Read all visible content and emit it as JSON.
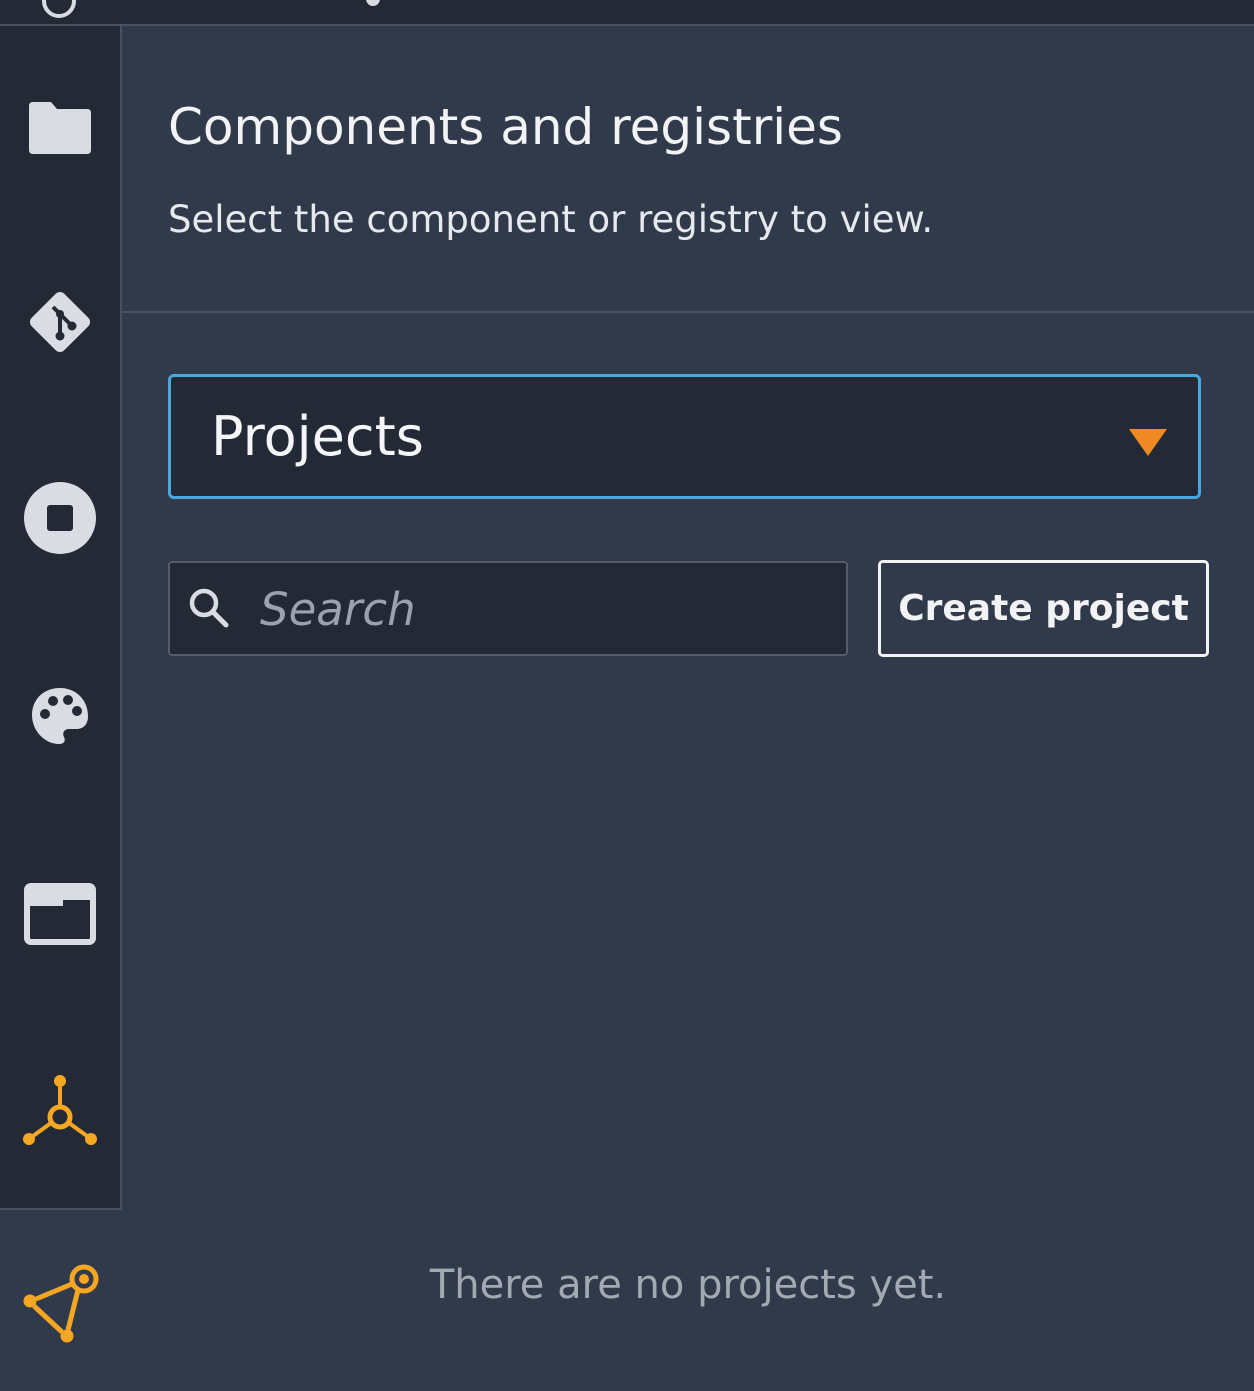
{
  "activity_bar": {
    "items": [
      {
        "icon": "folder-icon",
        "active": false
      },
      {
        "icon": "git-icon",
        "active": false
      },
      {
        "icon": "stop-icon",
        "active": false
      },
      {
        "icon": "palette-icon",
        "active": false
      },
      {
        "icon": "window-icon",
        "active": false
      },
      {
        "icon": "component-graph-icon",
        "active": true
      }
    ],
    "bottom_item": {
      "icon": "registry-graph-icon"
    }
  },
  "panel": {
    "title": "Components and registries",
    "subtitle": "Select the component or registry to view."
  },
  "selector": {
    "selected": "Projects"
  },
  "search": {
    "placeholder": "Search",
    "value": ""
  },
  "actions": {
    "create_label": "Create project"
  },
  "empty_state": {
    "message": "There are no projects yet."
  },
  "colors": {
    "background": "#313a4a",
    "sidebar": "#232a36",
    "accent_orange": "#f08a24",
    "accent_yellow": "#f5a623",
    "focus_blue": "#4aa7e0"
  }
}
